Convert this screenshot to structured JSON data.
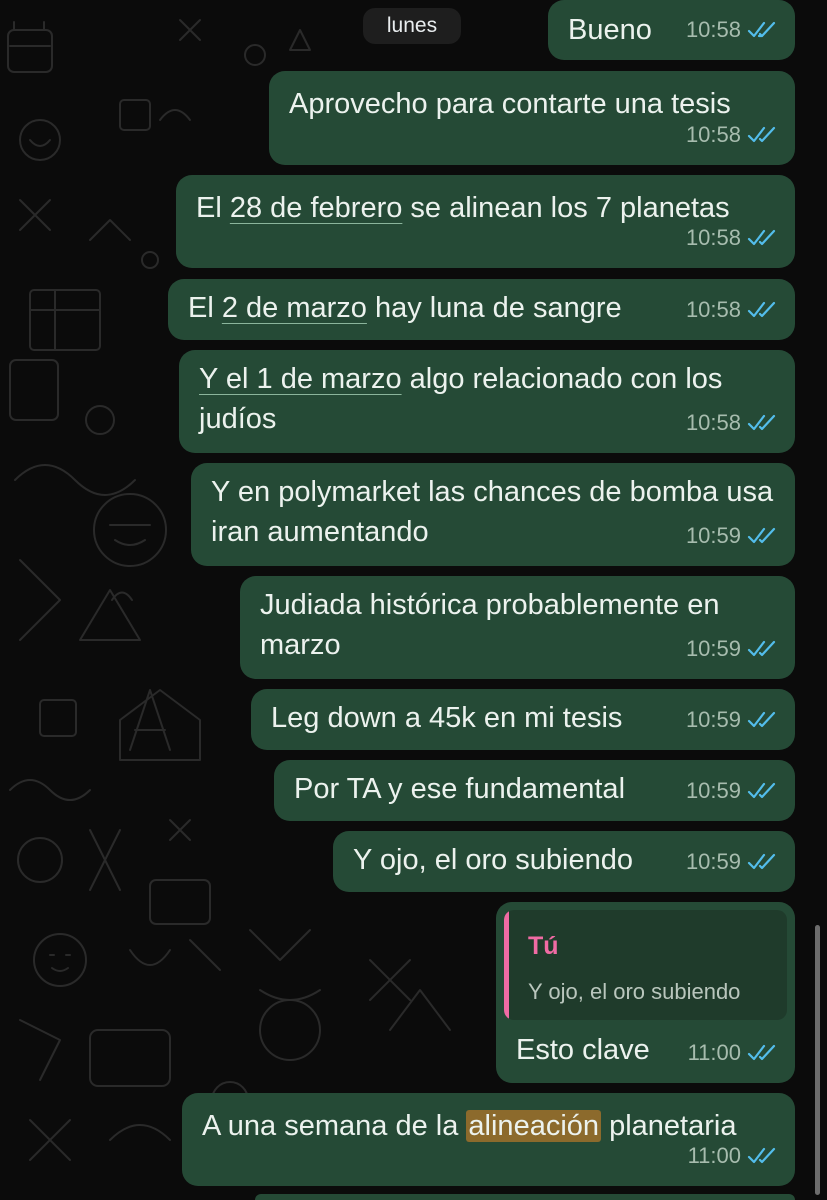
{
  "day_label": "lunes",
  "messages": [
    {
      "time": "10:58",
      "parts": [
        {
          "text": "Bueno"
        }
      ]
    },
    {
      "time": "10:58",
      "parts": [
        {
          "text": "Aprovecho para contarte una tesis"
        }
      ]
    },
    {
      "time": "10:58",
      "parts": [
        {
          "text": "El "
        },
        {
          "text": "28 de febrero",
          "link": true
        },
        {
          "text": " se alinean los 7 planetas"
        }
      ]
    },
    {
      "time": "10:58",
      "parts": [
        {
          "text": "El "
        },
        {
          "text": "2 de marzo",
          "link": true
        },
        {
          "text": " hay luna de sangre"
        }
      ]
    },
    {
      "time": "10:58",
      "parts": [
        {
          "text": "Y el 1 de marzo",
          "link": true
        },
        {
          "text": " algo relacionado con los judíos"
        }
      ]
    },
    {
      "time": "10:59",
      "parts": [
        {
          "text": "Y en polymarket las chances de bomba usa iran aumentando"
        }
      ]
    },
    {
      "time": "10:59",
      "parts": [
        {
          "text": "Judiada histórica probablemente en marzo"
        }
      ]
    },
    {
      "time": "10:59",
      "parts": [
        {
          "text": "Leg down a 45k en mi tesis"
        }
      ]
    },
    {
      "time": "10:59",
      "parts": [
        {
          "text": "Por TA y ese fundamental"
        }
      ]
    },
    {
      "time": "10:59",
      "parts": [
        {
          "text": "Y ojo, el oro subiendo"
        }
      ]
    }
  ],
  "reply": {
    "quoted_author": "Tú",
    "quoted_text": "Y ojo, el oro subiendo",
    "text": "Esto clave",
    "time": "11:00"
  },
  "last_message": {
    "time": "11:00",
    "parts": [
      {
        "text": "A una semana de la "
      },
      {
        "text": "alineación",
        "highlight": true
      },
      {
        "text": " planetaria"
      }
    ]
  },
  "colors": {
    "background": "#0b0b0b",
    "outgoing_bubble": "#254a36",
    "read_ticks": "#53bdeb",
    "quote_accent": "#f06ba4",
    "search_highlight": "#8c6a2c"
  },
  "icons": {
    "read_status": "double-check-icon"
  }
}
